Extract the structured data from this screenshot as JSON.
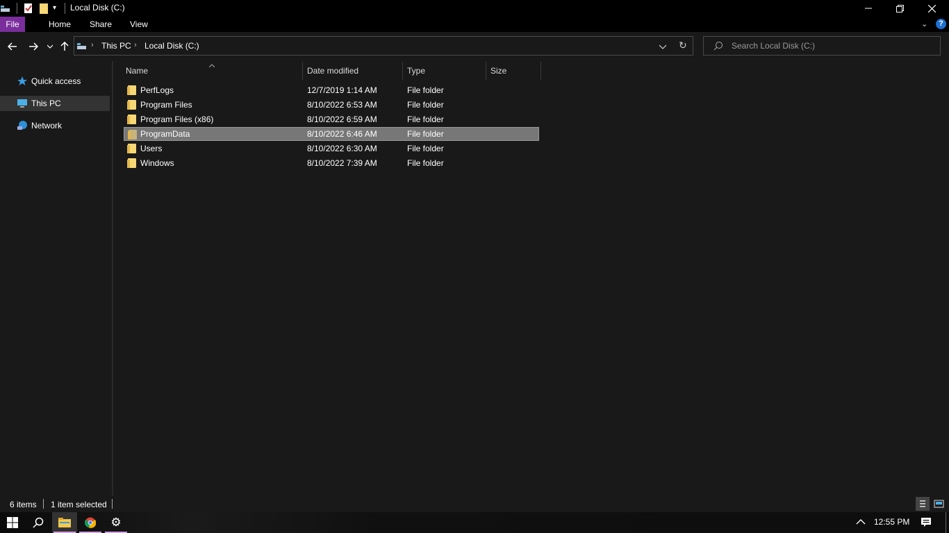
{
  "window": {
    "title": "Local Disk (C:)"
  },
  "ribbon": {
    "tabs": [
      "File",
      "Home",
      "Share",
      "View"
    ]
  },
  "address": {
    "crumbs": [
      "This PC",
      "Local Disk (C:)"
    ]
  },
  "search": {
    "placeholder": "Search Local Disk (C:)"
  },
  "sidebar": {
    "items": [
      {
        "label": "Quick access",
        "icon": "star-icon"
      },
      {
        "label": "This PC",
        "icon": "computer-icon",
        "selected": true
      },
      {
        "label": "Network",
        "icon": "network-icon"
      }
    ]
  },
  "columns": [
    "Name",
    "Date modified",
    "Type",
    "Size"
  ],
  "files": [
    {
      "name": "PerfLogs",
      "date": "12/7/2019 1:14 AM",
      "type": "File folder",
      "size": ""
    },
    {
      "name": "Program Files",
      "date": "8/10/2022 6:53 AM",
      "type": "File folder",
      "size": ""
    },
    {
      "name": "Program Files (x86)",
      "date": "8/10/2022 6:59 AM",
      "type": "File folder",
      "size": ""
    },
    {
      "name": "ProgramData",
      "date": "8/10/2022 6:46 AM",
      "type": "File folder",
      "size": "",
      "selected": true
    },
    {
      "name": "Users",
      "date": "8/10/2022 6:30 AM",
      "type": "File folder",
      "size": ""
    },
    {
      "name": "Windows",
      "date": "8/10/2022 7:39 AM",
      "type": "File folder",
      "size": ""
    }
  ],
  "status": {
    "count": "6 items",
    "selection": "1 item selected"
  },
  "taskbar": {
    "time": "12:55 PM"
  },
  "colors": {
    "accent_file_tab": "#7a2e9c",
    "selected_row": "#777777",
    "folder": "#f8d775"
  }
}
